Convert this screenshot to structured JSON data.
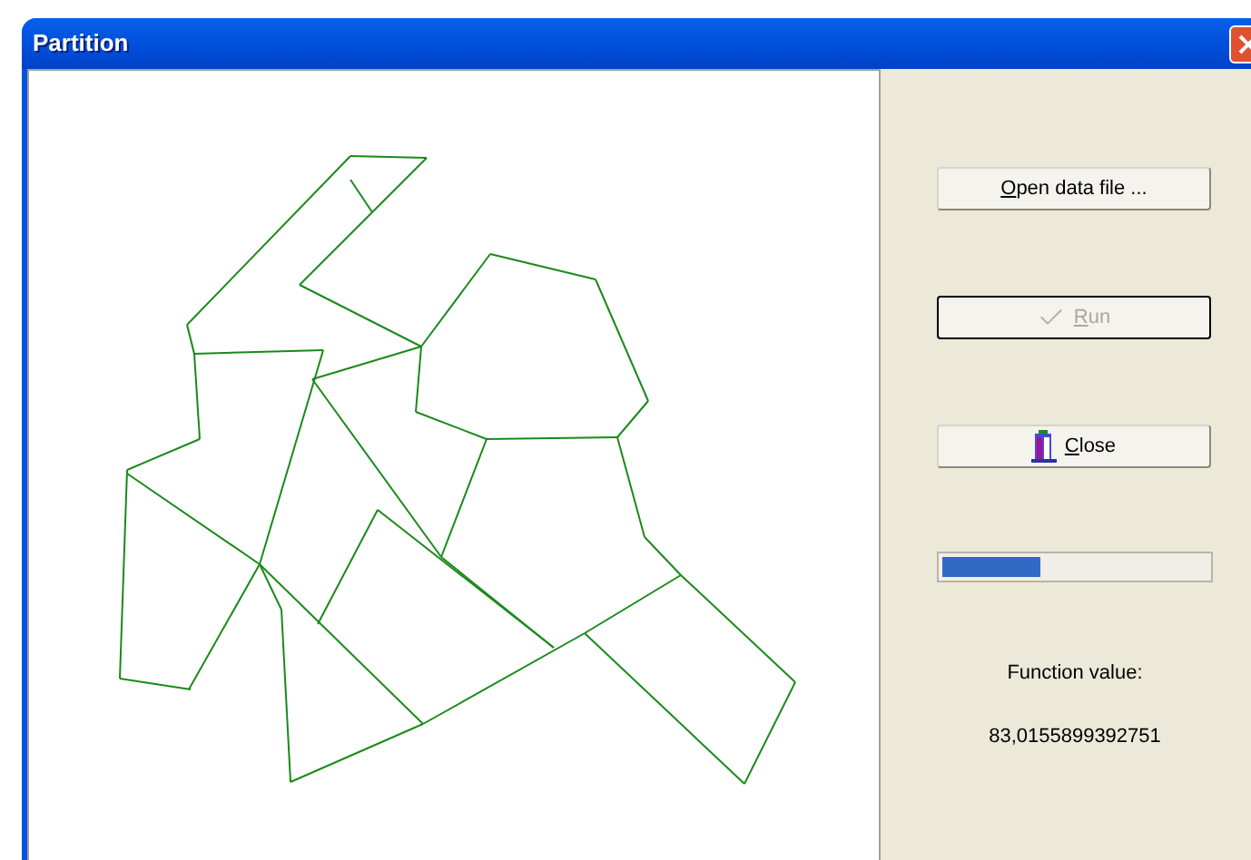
{
  "window": {
    "title": "Partition"
  },
  "buttons": [
    {
      "kind": "open",
      "label": "Open data file ...",
      "underline_first": true,
      "disabled": false,
      "default": false
    },
    {
      "kind": "run",
      "label": "Run",
      "underline_first": true,
      "disabled": true,
      "default": true
    },
    {
      "kind": "close",
      "label": "Close",
      "underline_first": true,
      "disabled": false,
      "default": false
    }
  ],
  "progress": {
    "level": 0.37
  },
  "function_label": "Function value:",
  "function_value": "83,0155899392751"
}
